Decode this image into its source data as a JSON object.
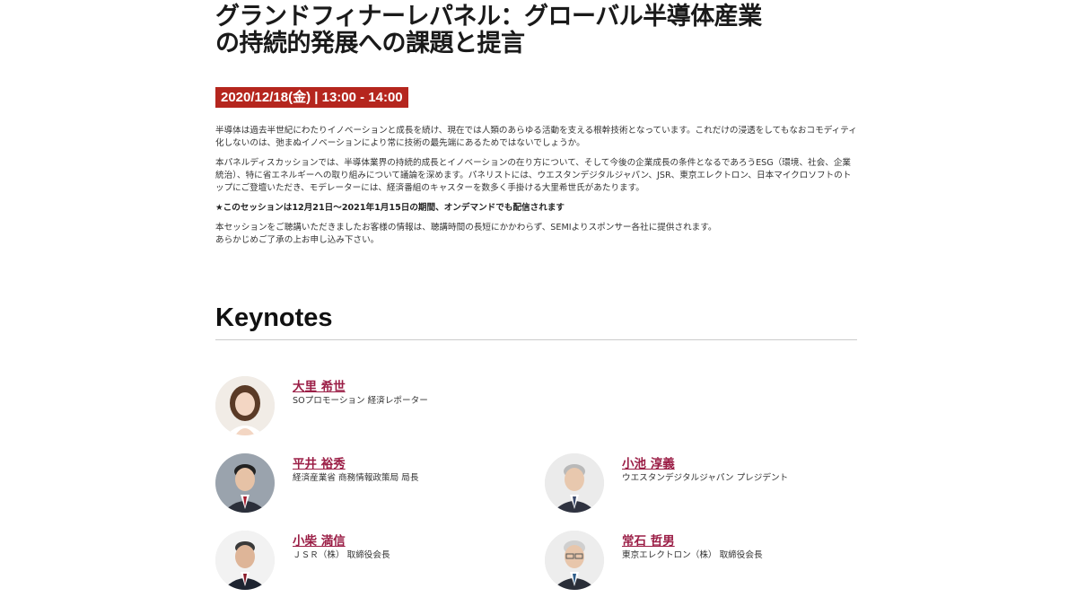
{
  "session": {
    "title_line1": "グランドフィナーレパネル：グローバル半導体産業",
    "title_line2": "の持続的発展への課題と提言",
    "datetime": "2020/12/18(金) | 13:00 - 14:00",
    "paragraphs": [
      "半導体は過去半世紀にわたりイノベーションと成長を続け、現在では人類のあらゆる活動を支える根幹技術となっています。これだけの浸透をしてもなおコモディティ化しないのは、弛まぬイノベーションにより常に技術の最先端にあるためではないでしょうか。",
      "本パネルディスカッションでは、半導体業界の持続的成長とイノベーションの在り方について、そして今後の企業成長の条件となるであろうESG（環境、社会、企業統治）、特に省エネルギーへの取り組みについて議論を深めます。パネリストには、ウエスタンデジタルジャパン、JSR、東京エレクトロン、日本マイクロソフトのトップにご登壇いただき、モデレーターには、経済番組のキャスターを数多く手掛ける大里希世氏があたります。",
      "★このセッションは12月21日～2021年1月15日の期間、オンデマンドでも配信されます",
      "本セッションをご聴講いただきましたお客様の情報は、聴講時間の長短にかかわらず、SEMIよりスポンサー各社に提供されます。",
      "あらかじめご了承の上お申し込み下さい。"
    ]
  },
  "keynotes": {
    "heading": "Keynotes",
    "speakers": [
      {
        "name": "大里 希世",
        "role": "SOプロモーション 経済レポーター"
      },
      {
        "name": "平井 裕秀",
        "role": "経済産業省 商務情報政策局 局長"
      },
      {
        "name": "小池 淳義",
        "role": "ウエスタンデジタルジャパン プレジデント"
      },
      {
        "name": "小柴 満信",
        "role": "ＪＳＲ（株） 取締役会長"
      },
      {
        "name": "常石 哲男",
        "role": "東京エレクトロン（株） 取締役会長"
      }
    ]
  },
  "colors": {
    "accent": "#b5261e",
    "speaker_name": "#9b1e46"
  }
}
